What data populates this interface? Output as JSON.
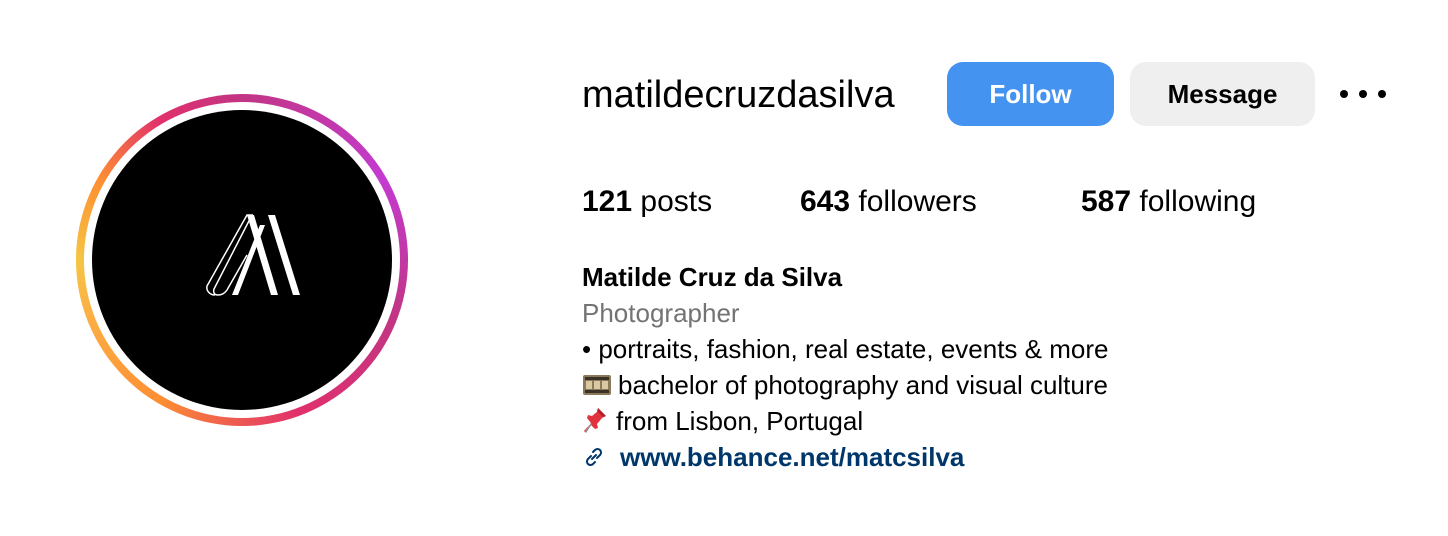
{
  "profile": {
    "username": "matildecruzdasilva",
    "full_name": "Matilde Cruz da Silva",
    "category": "Photographer"
  },
  "actions": {
    "follow_label": "Follow",
    "message_label": "Message",
    "more_icon": "ellipsis-icon"
  },
  "stats": {
    "posts_count": "121",
    "posts_label": "posts",
    "followers_count": "643",
    "followers_label": "followers",
    "following_count": "587",
    "following_label": "following"
  },
  "bio": {
    "line1": "• portraits, fashion, real estate, events & more",
    "line2_icon": "film-frames-icon",
    "line2": "bachelor of photography and visual culture",
    "line3_icon": "pushpin-icon",
    "line3": "from Lisbon, Portugal",
    "link_icon": "link-icon",
    "link": "www.behance.net/matcsilva"
  },
  "colors": {
    "follow_button": "#4593f0",
    "message_button": "#efefef",
    "link_text": "#00376b",
    "category_text": "#737373"
  }
}
